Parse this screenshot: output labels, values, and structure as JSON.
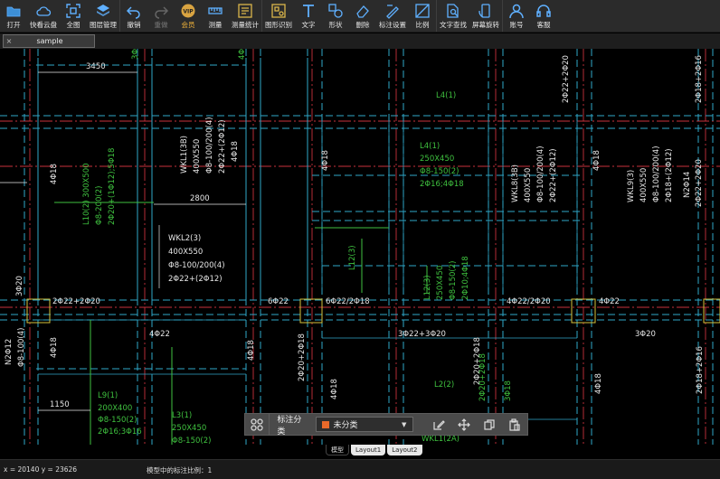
{
  "toolbar": {
    "groups": [
      [
        {
          "name": "open",
          "label": "打开",
          "icon": "folder-icon"
        },
        {
          "name": "cloud",
          "label": "快看云盘",
          "icon": "cloud-icon"
        },
        {
          "name": "fullview",
          "label": "全图",
          "icon": "fullscreen-icon"
        },
        {
          "name": "layers",
          "label": "图层管理",
          "icon": "layers-icon"
        }
      ],
      [
        {
          "name": "undo",
          "label": "撤销",
          "icon": "undo-icon"
        },
        {
          "name": "redo",
          "label": "重做",
          "icon": "redo-icon",
          "disabled": true
        },
        {
          "name": "vip",
          "label": "会员",
          "icon": "vip-icon",
          "vip": true
        },
        {
          "name": "measure",
          "label": "测量",
          "icon": "ruler-icon"
        },
        {
          "name": "measure-stats",
          "label": "测量统计",
          "icon": "stats-icon"
        }
      ],
      [
        {
          "name": "shape-recognition",
          "label": "图形识别",
          "icon": "shape-scan-icon"
        },
        {
          "name": "text",
          "label": "文字",
          "icon": "text-icon"
        },
        {
          "name": "shape",
          "label": "形状",
          "icon": "shape-icon"
        },
        {
          "name": "delete",
          "label": "删除",
          "icon": "eraser-icon"
        },
        {
          "name": "annotation-settings",
          "label": "标注设置",
          "icon": "annotation-settings-icon"
        },
        {
          "name": "ratio",
          "label": "比例",
          "icon": "ratio-icon"
        }
      ],
      [
        {
          "name": "text-search",
          "label": "文字查找",
          "icon": "text-search-icon"
        },
        {
          "name": "rotate-screen",
          "label": "屏幕旋转",
          "icon": "rotate-screen-icon"
        }
      ],
      [
        {
          "name": "account",
          "label": "账号",
          "icon": "user-icon"
        },
        {
          "name": "support",
          "label": "客服",
          "icon": "headset-icon"
        }
      ]
    ]
  },
  "file_tab": {
    "close": "×",
    "name": "sample"
  },
  "drawing": {
    "labels_white": [
      {
        "id": "dim-3450",
        "text": "3450"
      },
      {
        "id": "dim-2800",
        "text": "2800"
      },
      {
        "id": "dim-1150",
        "text": "1150"
      },
      {
        "id": "wkl2-1",
        "text": "WKL2(3)"
      },
      {
        "id": "wkl2-2",
        "text": "400X550"
      },
      {
        "id": "wkl2-3",
        "text": "Φ8-100/200(4)"
      },
      {
        "id": "wkl2-4",
        "text": "2Φ22+(2Φ12)"
      },
      {
        "id": "bot-1",
        "text": "2Φ22+2Φ20"
      },
      {
        "id": "bot-2",
        "text": "6Φ22"
      },
      {
        "id": "bot-3",
        "text": "6Φ22/2Φ18"
      },
      {
        "id": "bot-4",
        "text": "4Φ22/2Φ20"
      },
      {
        "id": "bot-5",
        "text": "4Φ22"
      },
      {
        "id": "bot-6",
        "text": "4Φ22"
      },
      {
        "id": "bot-7",
        "text": "3Φ22+3Φ20"
      },
      {
        "id": "bot-8",
        "text": "3Φ20"
      }
    ],
    "labels_white_vertical": [
      {
        "id": "v-4f18-a",
        "text": "4Φ18"
      },
      {
        "id": "v-4f18-b",
        "text": "4Φ18"
      },
      {
        "id": "v-4f18-c",
        "text": "4Φ18"
      },
      {
        "id": "v-4f18-d",
        "text": "4Φ18"
      },
      {
        "id": "v-4f18-e",
        "text": "4Φ18"
      },
      {
        "id": "v-4f18-f",
        "text": "4Φ18"
      },
      {
        "id": "v-4f18-g",
        "text": "4Φ18"
      },
      {
        "id": "v-4f18-h",
        "text": "4Φ18"
      },
      {
        "id": "wkl1-1",
        "text": "WKL1(3B)"
      },
      {
        "id": "wkl1-2",
        "text": "400X550"
      },
      {
        "id": "wkl1-3",
        "text": "Φ8-100/200(4)"
      },
      {
        "id": "wkl1-4",
        "text": "2Φ22+(2Φ12)"
      },
      {
        "id": "wkl8-1",
        "text": "WKL8(3B)"
      },
      {
        "id": "wkl8-2",
        "text": "400X550"
      },
      {
        "id": "wkl8-3",
        "text": "Φ8-100/200(4)"
      },
      {
        "id": "wkl8-4",
        "text": "2Φ22+(2Φ12)"
      },
      {
        "id": "wkl9-1",
        "text": "WKL9(3)"
      },
      {
        "id": "wkl9-2",
        "text": "400X550"
      },
      {
        "id": "wkl9-3",
        "text": "Φ8-100/200(4)"
      },
      {
        "id": "wkl9-4",
        "text": "2Φ18+(2Φ12)"
      },
      {
        "id": "wkl9-5",
        "text": "N2Φ14"
      },
      {
        "id": "top-r1",
        "text": "2Φ22+2Φ20"
      },
      {
        "id": "top-r2",
        "text": "2Φ18+2Φ16"
      },
      {
        "id": "top-r3",
        "text": "2Φ22+2Φ20"
      },
      {
        "id": "left-side",
        "text": "N2Φ12"
      },
      {
        "id": "left-side2",
        "text": "Φ8-100(4)"
      },
      {
        "id": "left-side3",
        "text": "3Φ20"
      },
      {
        "id": "r-low1",
        "text": "2Φ18+2Φ16"
      },
      {
        "id": "r-low2",
        "text": "2Φ20+2Φ18"
      },
      {
        "id": "mid-low",
        "text": "2Φ20+2Φ18"
      }
    ],
    "labels_green": [
      {
        "id": "l4-top",
        "text": "L4(1)"
      },
      {
        "id": "l4-1",
        "text": "L4(1)"
      },
      {
        "id": "l4-2",
        "text": "250X450"
      },
      {
        "id": "l4-3",
        "text": "Φ8-150(2)"
      },
      {
        "id": "l4-4",
        "text": "2Φ16;4Φ18"
      },
      {
        "id": "l9-1",
        "text": "L9(1)"
      },
      {
        "id": "l9-2",
        "text": "200X400"
      },
      {
        "id": "l9-3",
        "text": "Φ8-150(2)"
      },
      {
        "id": "l9-4",
        "text": "2Φ16;3Φ16"
      },
      {
        "id": "l3-1",
        "text": "L3(1)"
      },
      {
        "id": "l3-2",
        "text": "250X450"
      },
      {
        "id": "l3-3",
        "text": "Φ8-150(2)"
      },
      {
        "id": "l2-1",
        "text": "L2(2)"
      },
      {
        "id": "wkl1-2a",
        "text": "WKL1(2A)"
      }
    ],
    "labels_green_vertical": [
      {
        "id": "l10-1",
        "text": "L10(2) 300X500"
      },
      {
        "id": "l10-2",
        "text": "Φ8-200(2)"
      },
      {
        "id": "l10-3",
        "text": "2Φ20+(1Φ12);5Φ18"
      },
      {
        "id": "l12-1",
        "text": "L12(3)"
      },
      {
        "id": "l12b-1",
        "text": "L12(3)"
      },
      {
        "id": "l12b-2",
        "text": "250X450"
      },
      {
        "id": "l12b-3",
        "text": "Φ8-150(2)"
      },
      {
        "id": "l12b-4",
        "text": "2Φ10;4Φ18"
      },
      {
        "id": "top-g1",
        "text": "3Φ18"
      },
      {
        "id": "top-g2",
        "text": "4Φ20"
      },
      {
        "id": "mid-g1",
        "text": "3Φ18"
      },
      {
        "id": "mid-g2",
        "text": "2Φ20+2Φ18"
      }
    ]
  },
  "annotation_bar": {
    "label": "标注分类",
    "selected": "未分类",
    "swatch_color": "#e8692a"
  },
  "layout_tabs": [
    "模型",
    "Layout1",
    "Layout2"
  ],
  "status": {
    "coords": "x = 20140 y = 23626",
    "scale": "模型中的标注比例：1"
  },
  "colors": {
    "cyan": "#2fa7c9",
    "red": "#c8323c",
    "green": "#3fc13f",
    "yellow": "#d6c23a",
    "white": "#e6e6e6"
  }
}
